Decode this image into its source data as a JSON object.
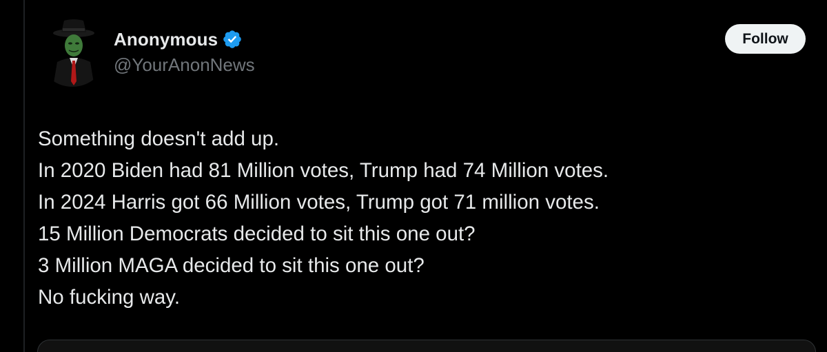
{
  "author": {
    "display_name": "Anonymous",
    "handle": "@YourAnonNews",
    "verified": true,
    "verified_color": "#1d9bf0",
    "avatar": "anonymous-mask-avatar"
  },
  "actions": {
    "follow_label": "Follow"
  },
  "tweet": {
    "lines": [
      "Something doesn't add up.",
      "In 2020 Biden had 81 Million votes, Trump had 74 Million votes.",
      "In 2024 Harris got 66 Million votes, Trump got 71 million votes.",
      "15 Million Democrats decided to sit this one out?",
      "3 Million MAGA decided to sit this one out?",
      "No fucking way."
    ]
  },
  "colors": {
    "background": "#000000",
    "text_primary": "#e7e9ea",
    "text_secondary": "#71767b",
    "button_bg": "#eff3f4"
  }
}
